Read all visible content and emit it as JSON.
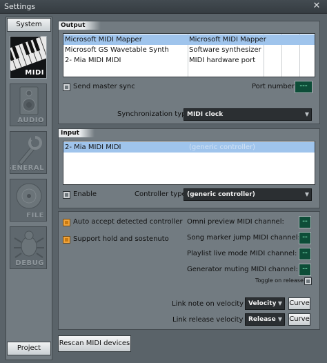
{
  "window": {
    "title": "Settings",
    "close_glyph": "✕"
  },
  "sidebar": {
    "system_tab": "System",
    "project_tab": "Project",
    "categories": [
      {
        "label": "MIDI",
        "icon": "keyboard-icon"
      },
      {
        "label": "AUDIO",
        "icon": "speaker-icon"
      },
      {
        "label": "GENERAL",
        "icon": "wrench-icon"
      },
      {
        "label": "FILE",
        "icon": "disk-icon"
      },
      {
        "label": "DEBUG",
        "icon": "bug-icon"
      }
    ]
  },
  "output": {
    "header": "Output",
    "rows": [
      {
        "name": "Microsoft MIDI Mapper",
        "type": "Microsoft MIDI Mapper",
        "selected": true
      },
      {
        "name": "Microsoft GS Wavetable Synth",
        "type": "Software synthesizer",
        "selected": false
      },
      {
        "name": "2- Mia MIDI MIDI",
        "type": "MIDI hardware port",
        "selected": false
      }
    ],
    "send_master_sync": "Send master sync",
    "port_number_label": "Port number:",
    "port_number_value": "---",
    "sync_type_label": "Synchronization type:",
    "sync_type_value": "MIDI clock"
  },
  "input": {
    "header": "Input",
    "rows": [
      {
        "name": "2- Mia MIDI MIDI",
        "controller": "(generic controller)",
        "selected": true
      }
    ],
    "enable_label": "Enable",
    "controller_type_label": "Controller type:",
    "controller_type_value": "(generic controller)"
  },
  "midi_options": {
    "auto_accept": "Auto accept detected controller",
    "support_hold": "Support hold and sostenuto",
    "omni_preview": "Omni preview MIDI channel:",
    "song_marker": "Song marker jump MIDI channel:",
    "playlist_live": "Playlist live mode MIDI channel:",
    "generator_muting": "Generator muting MIDI channel:",
    "channel_value": "--",
    "toggle_on_release": "Toggle on release",
    "link_note_label": "Link note on velocity to:",
    "link_note_value": "Velocity",
    "link_release_label": "Link release velocity to:",
    "link_release_value": "Release",
    "curve_label": "Curve"
  },
  "rescan_button": "Rescan MIDI devices",
  "colors": {
    "selection": "#9fc4ec",
    "lcd_background": "#0d4d38",
    "lcd_text": "#6fd3a8",
    "checkbox_orange": "#f2a43a"
  }
}
